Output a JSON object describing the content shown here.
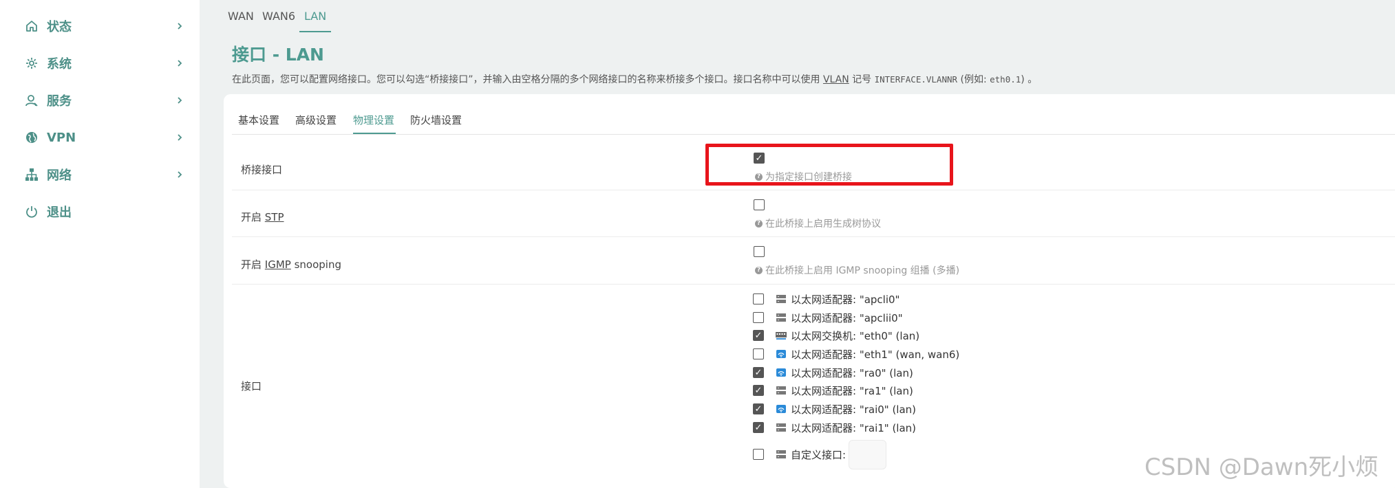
{
  "sidebar": {
    "items": [
      {
        "label": "状态",
        "icon": "home-icon"
      },
      {
        "label": "系统",
        "icon": "gear-icon"
      },
      {
        "label": "服务",
        "icon": "user-icon"
      },
      {
        "label": "VPN",
        "icon": "globe-icon"
      },
      {
        "label": "网络",
        "icon": "network-icon"
      },
      {
        "label": "退出",
        "icon": "power-icon"
      }
    ]
  },
  "interface_tabs": [
    "WAN",
    "WAN6",
    "LAN"
  ],
  "interface_tab_active": "LAN",
  "page": {
    "title": "接口 - LAN",
    "desc_part1": "在此页面，您可以配置网络接口。您可以勾选“桥接接口”，并输入由空格分隔的多个网络接口的名称来桥接多个接口。接口名称中可以使用 ",
    "desc_vlan": "VLAN",
    "desc_part2": " 记号 ",
    "desc_code1": "INTERFACE.VLANNR",
    "desc_part3": " (例如: ",
    "desc_code2": "eth0.1",
    "desc_part4": ") 。"
  },
  "sub_tabs": [
    "基本设置",
    "高级设置",
    "物理设置",
    "防火墙设置"
  ],
  "sub_tab_active": "物理设置",
  "form": {
    "bridge": {
      "label": "桥接接口",
      "checked": true,
      "hint": "为指定接口创建桥接"
    },
    "stp": {
      "label_prefix": "开启 ",
      "label_abbr": "STP",
      "checked": false,
      "hint": "在此桥接上启用生成树协议"
    },
    "igmp": {
      "label_prefix": "开启 ",
      "label_abbr": "IGMP",
      "label_suffix": " snooping",
      "checked": false,
      "hint": "在此桥接上启用 IGMP snooping 组播 (多播)"
    },
    "interfaces": {
      "label": "接口",
      "items": [
        {
          "text": "以太网适配器: \"apcli0\"",
          "checked": false,
          "icon": "ethernet-icon"
        },
        {
          "text": "以太网适配器: \"apclii0\"",
          "checked": false,
          "icon": "ethernet-icon"
        },
        {
          "text": "以太网交换机: \"eth0\" (lan)",
          "checked": true,
          "icon": "switch-icon"
        },
        {
          "text": "以太网适配器: \"eth1\" (wan, wan6)",
          "checked": false,
          "icon": "wifi-adapter-icon"
        },
        {
          "text": "以太网适配器: \"ra0\" (lan)",
          "checked": true,
          "icon": "wifi-adapter-icon"
        },
        {
          "text": "以太网适配器: \"ra1\" (lan)",
          "checked": true,
          "icon": "ethernet-icon"
        },
        {
          "text": "以太网适配器: \"rai0\" (lan)",
          "checked": true,
          "icon": "wifi-adapter-icon"
        },
        {
          "text": "以太网适配器: \"rai1\" (lan)",
          "checked": true,
          "icon": "ethernet-icon"
        }
      ],
      "custom": {
        "label": "自定义接口:",
        "checked": false,
        "value": ""
      }
    }
  },
  "watermark": "CSDN @Dawn死小烦",
  "colors": {
    "accent": "#4d9a90",
    "highlight": "#e8141b"
  }
}
